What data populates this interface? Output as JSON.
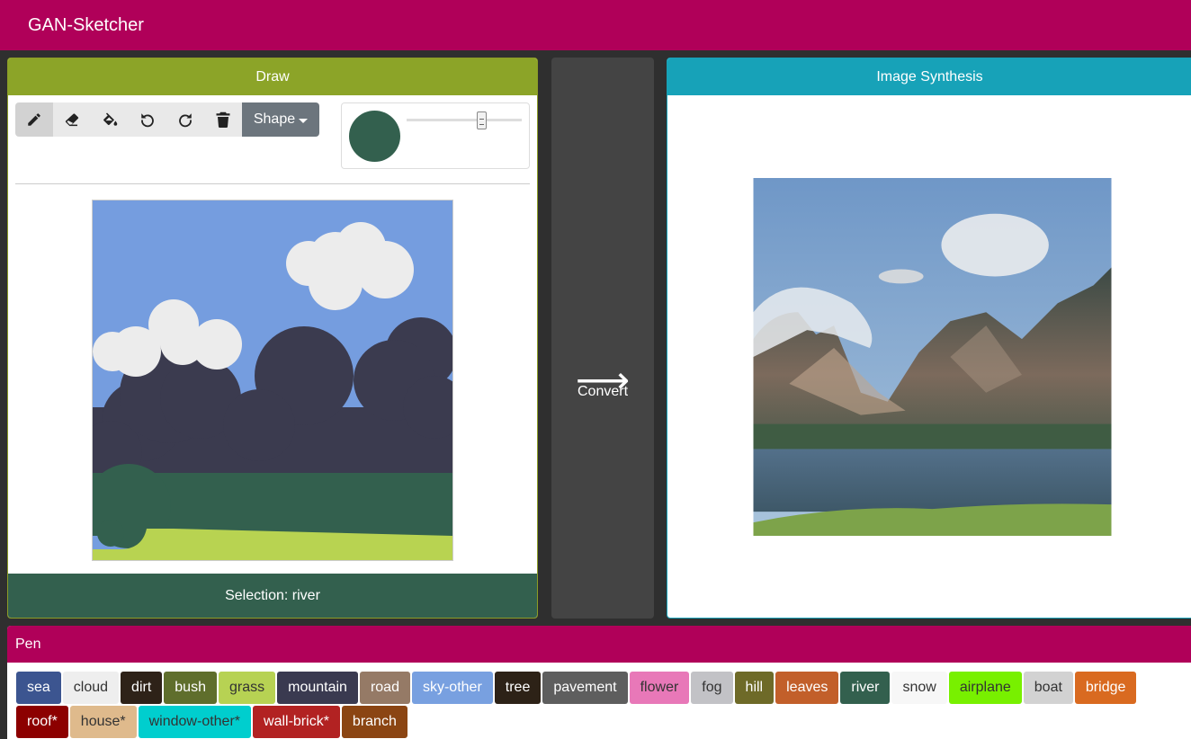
{
  "app": {
    "title": "GAN-Sketcher"
  },
  "draw": {
    "header": "Draw",
    "toolbar": {
      "tools": [
        "pencil-icon",
        "eraser-icon",
        "fill-bucket-icon",
        "undo-icon",
        "redo-icon",
        "trash-icon"
      ],
      "active_tool": "pencil",
      "shape_label": "Shape"
    },
    "brush": {
      "color": "#33604e",
      "size_fraction": 0.65
    },
    "selection_text": "Selection: river",
    "selection_color": "#33604e"
  },
  "convert": {
    "arrow": "⟶",
    "label": "Convert"
  },
  "synthesis": {
    "header": "Image Synthesis"
  },
  "pen": {
    "header": "Pen",
    "labels": [
      {
        "name": "sea",
        "bg": "#3c5590",
        "fg": "#ffffff"
      },
      {
        "name": "cloud",
        "bg": "#eeeeee",
        "fg": "#333333"
      },
      {
        "name": "dirt",
        "bg": "#2e2218",
        "fg": "#ffffff"
      },
      {
        "name": "bush",
        "bg": "#5f6e2c",
        "fg": "#ffffff"
      },
      {
        "name": "grass",
        "bg": "#b7d253",
        "fg": "#333333"
      },
      {
        "name": "mountain",
        "bg": "#3a3a50",
        "fg": "#ffffff"
      },
      {
        "name": "road",
        "bg": "#957a66",
        "fg": "#ffffff"
      },
      {
        "name": "sky-other",
        "bg": "#78a0e0",
        "fg": "#ffffff"
      },
      {
        "name": "tree",
        "bg": "#2d2217",
        "fg": "#ffffff"
      },
      {
        "name": "pavement",
        "bg": "#5e5e5e",
        "fg": "#ffffff"
      },
      {
        "name": "flower",
        "bg": "#e878b8",
        "fg": "#333333"
      },
      {
        "name": "fog",
        "bg": "#c2c2c6",
        "fg": "#333333"
      },
      {
        "name": "hill",
        "bg": "#6e6a28",
        "fg": "#ffffff"
      },
      {
        "name": "leaves",
        "bg": "#c25f2a",
        "fg": "#ffffff"
      },
      {
        "name": "river",
        "bg": "#33604e",
        "fg": "#ffffff"
      },
      {
        "name": "snow",
        "bg": "#f7f7f7",
        "fg": "#333333"
      },
      {
        "name": "airplane",
        "bg": "#78f000",
        "fg": "#333333"
      },
      {
        "name": "boat",
        "bg": "#d2d2d2",
        "fg": "#333333"
      },
      {
        "name": "bridge",
        "bg": "#d96a20",
        "fg": "#ffffff"
      },
      {
        "name": "roof*",
        "bg": "#8c0000",
        "fg": "#ffffff"
      },
      {
        "name": "house*",
        "bg": "#dfba8c",
        "fg": "#333333"
      },
      {
        "name": "window-other*",
        "bg": "#00cece",
        "fg": "#333333"
      },
      {
        "name": "wall-brick*",
        "bg": "#b22222",
        "fg": "#ffffff"
      },
      {
        "name": "branch",
        "bg": "#8b4513",
        "fg": "#ffffff"
      }
    ]
  }
}
